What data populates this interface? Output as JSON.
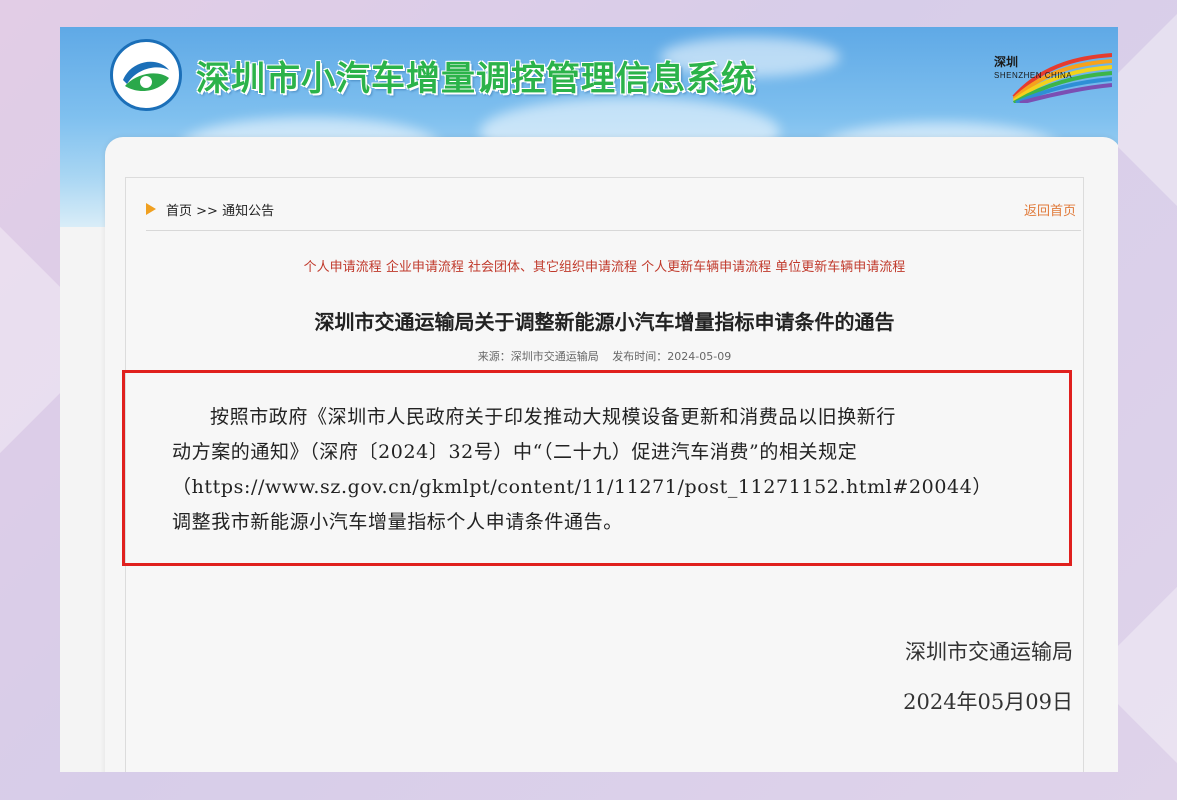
{
  "header": {
    "site_title": "深圳市小汽车增量调控管理信息系统",
    "logo_left_text": "深圳市交通运输局",
    "logo_right_text": "深圳",
    "logo_right_sub": "SHENZHEN CHINA"
  },
  "breadcrumb": {
    "home": "首页",
    "separator": ">>",
    "current": "通知公告",
    "back_label": "返回首页"
  },
  "process_links": [
    "个人申请流程",
    "企业申请流程",
    "社会团体、其它组织申请流程",
    "个人更新车辆申请流程",
    "单位更新车辆申请流程"
  ],
  "notice": {
    "title": "深圳市交通运输局关于调整新能源小汽车增量指标申请条件的通告",
    "source_label": "来源：深圳市交通运输局",
    "published_label": "发布时间：2024-05-09",
    "lines": [
      "按照市政府《深圳市人民政府关于印发推动大规模设备更新和消费品以旧换新行",
      "动方案的通知》（深府〔2024〕32号）中“（二十九）促进汽车消费”的相关规定",
      "（https://www.sz.gov.cn/gkmlpt/content/11/11271/post_11271152.html#20044）",
      "调整我市新能源小汽车增量指标个人申请条件通告。"
    ],
    "signature_org": "深圳市交通运输局",
    "signature_date": "2024年05月09日"
  },
  "colors": {
    "title_green": "#2bb34a",
    "link_red": "#c0392b",
    "highlight_border": "#e0201e",
    "back_link": "#e07a3a"
  }
}
